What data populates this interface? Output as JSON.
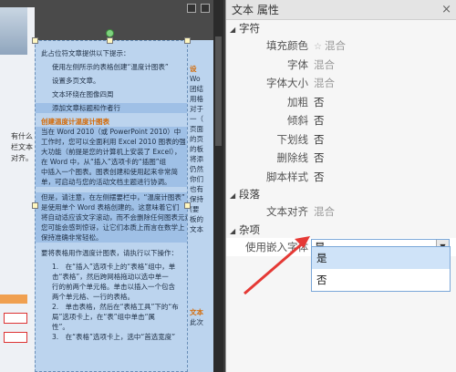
{
  "panel": {
    "title": "文本 属性",
    "close_glyph": "×",
    "sections": {
      "char": "字符",
      "para": "段落",
      "misc": "杂项"
    },
    "rows": {
      "fill": {
        "label": "填充颜色",
        "value": "混合"
      },
      "font": {
        "label": "字体",
        "value": "混合"
      },
      "size": {
        "label": "字体大小",
        "value": "混合"
      },
      "bold": {
        "label": "加粗",
        "value": "否"
      },
      "italic": {
        "label": "倾斜",
        "value": "否"
      },
      "underline": {
        "label": "下划线",
        "value": "否"
      },
      "strike": {
        "label": "删除线",
        "value": "否"
      },
      "script": {
        "label": "脚本样式",
        "value": "否"
      },
      "align": {
        "label": "文本对齐",
        "value": "混合"
      },
      "embed": {
        "label": "使用嵌入字体",
        "value": "是"
      }
    },
    "dropdown_options": [
      "是",
      "否"
    ]
  },
  "document": {
    "frame_lines": [
      "此占位符文章提供以下提示：",
      "使用左侧所示的表格创建“温度计图表”",
      "设置多页文章。",
      "文本环绕在图像四周",
      "添加文章标题和作者行",
      "创建温度计温度计图表",
      "当在 Word 2010（或 PowerPoint 2010）中",
      "工作时，您可以全面利用 Excel 2010 图表的强",
      "大功能（前提是您的计算机上安装了 Excel），",
      "在 Word 中，从“插入”选项卡的“插图”组",
      "中插入一个图表。图表创建和使用起来非常简",
      "单，可启动与您的活动文档主题进行协调。",
      "但是，请注意，在左侧摆要栏中，“温度计图表”",
      "是使用单个 Word 表格创建的。这意味着它们",
      "将自动适应该文字滚动，而不会删除任何图表元素。",
      "您可能会感到惊讶，让它们本质上而言在数学上",
      "保持准确非常轻松。",
      "要将表格用作温度计图表，请执行以下操作：",
      "1.　在“插入”选项卡上的“表格”组中，单",
      "击“表格”，然后跨网格拖动以选中单一",
      "行的前两个单元格。单击以插入一个包含",
      "两个单元格、一行的表格。",
      "2.　单击表格，然后在“表格工具”下的“布",
      "局”选项卡上，在“表”组中单击“属",
      "性”。",
      "3.　在“表格”选项卡上，选中“首选宽度”"
    ],
    "right_col_lines": [
      "设",
      "Wo",
      "团结",
      "用格",
      "",
      "对于",
      "一（",
      "页面",
      "的页",
      "的板",
      "将添",
      "",
      "仍然",
      "你们",
      "也有",
      "保持",
      "(要",
      "板的",
      "",
      "文本",
      "",
      "",
      "",
      "",
      "",
      "",
      "",
      "",
      "",
      "",
      "",
      "",
      "文本",
      "此次"
    ],
    "strip_text": [
      "有什么",
      "栏文本",
      "对齐。"
    ]
  }
}
